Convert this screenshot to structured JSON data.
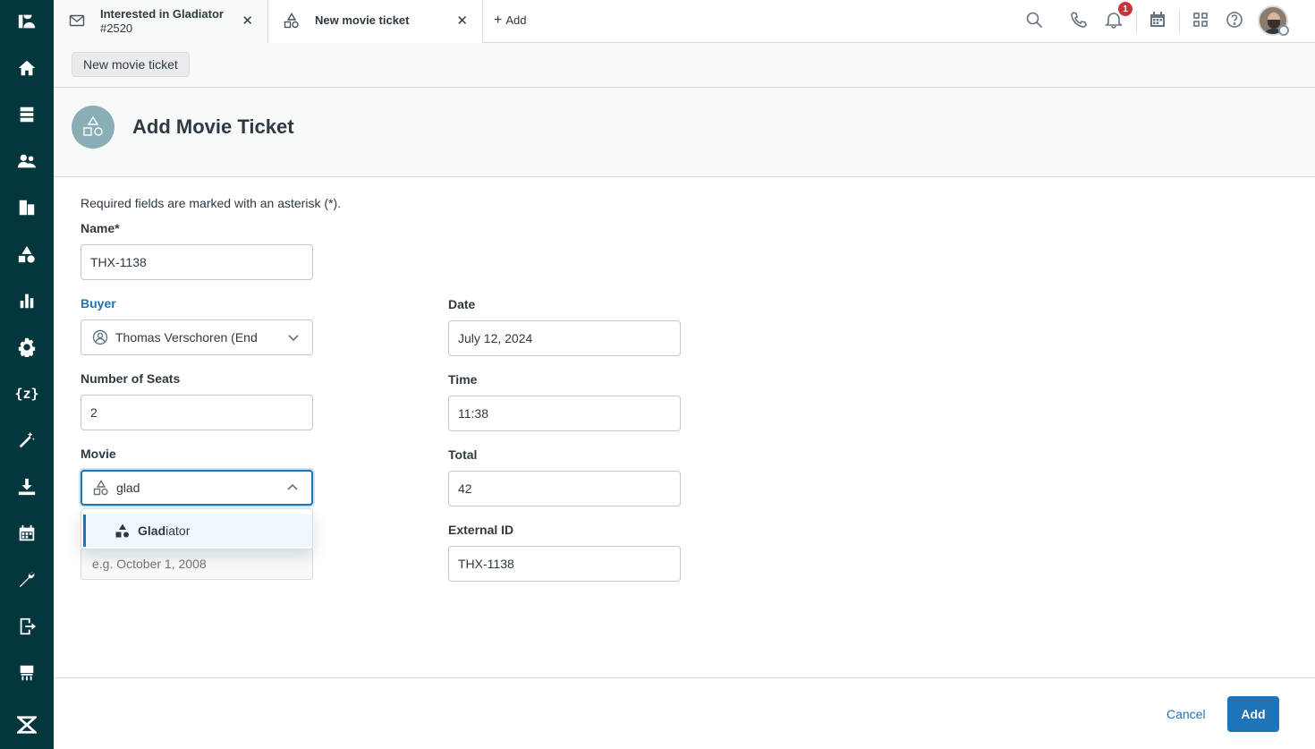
{
  "tabs": [
    {
      "title": "Interested in Gladiator",
      "subtitle": "#2520",
      "icon": "envelope-icon"
    },
    {
      "title": "New movie ticket",
      "icon": "shapes-icon"
    }
  ],
  "add_tab_label": "Add",
  "notification_count": "1",
  "breadcrumb": "New movie ticket",
  "page_title": "Add Movie Ticket",
  "form": {
    "required_note": "Required fields are marked with an asterisk (*).",
    "name": {
      "label": "Name*",
      "value": "THX-1138"
    },
    "buyer": {
      "label": "Buyer",
      "value": "Thomas Verschoren (End"
    },
    "seats": {
      "label": "Number of Seats",
      "value": "2"
    },
    "movie": {
      "label": "Movie",
      "value": "glad"
    },
    "movie_option": {
      "match": "Glad",
      "rest": "iator"
    },
    "hidden_date": {
      "placeholder": "e.g. October 1, 2008"
    },
    "date": {
      "label": "Date",
      "value": "July 12, 2024"
    },
    "time": {
      "label": "Time",
      "value": "11:38"
    },
    "total": {
      "label": "Total",
      "value": "42"
    },
    "external_id": {
      "label": "External ID",
      "value": "THX-1138"
    }
  },
  "footer": {
    "cancel_label": "Cancel",
    "add_label": "Add"
  },
  "colors": {
    "sidebar": "#03363d",
    "accent": "#1f73b7",
    "badge": "#cc3340"
  }
}
